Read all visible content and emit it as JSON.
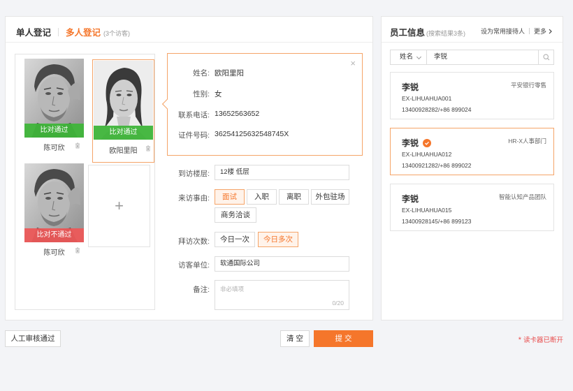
{
  "tabs": {
    "single": "单人登记",
    "multi": "多人登记",
    "multi_count": "(3个访客)"
  },
  "visitors": [
    {
      "name": "陈可欣",
      "result": "比对通过",
      "status": "pass"
    },
    {
      "name": "欧阳里阳",
      "result": "比对通过",
      "status": "pass"
    },
    {
      "name": "陈可欣",
      "result": "比对不通过",
      "status": "fail"
    }
  ],
  "info": {
    "name_label": "姓名:",
    "name_value": "欧阳里阳",
    "gender_label": "性别:",
    "gender_value": "女",
    "phone_label": "联系电话:",
    "phone_value": "13652563652",
    "id_label": "证件号码:",
    "id_value": "36254125632548745X",
    "close_glyph": "×"
  },
  "form": {
    "floor_label": "到访楼层:",
    "floor_value": "12楼  低层",
    "reason_label": "来访事由:",
    "reasons": [
      "面试",
      "入职",
      "离职",
      "外包驻场",
      "商务洽谈"
    ],
    "reason_selected": "面试",
    "visits_label": "拜访次数:",
    "visits": [
      "今日一次",
      "今日多次"
    ],
    "visits_selected": "今日多次",
    "company_label": "访客单位:",
    "company_value": "软通国际公司",
    "note_label": "备注:",
    "note_placeholder": "非必填项",
    "note_counter": "0/20"
  },
  "employees": {
    "title": "员工信息",
    "subtitle": "(搜索结果3条)",
    "set_frequent": "设为常用接待人",
    "more": "更多",
    "search_field": "姓名",
    "search_value": "李锐",
    "list": [
      {
        "name": "李锐",
        "dept": "平安银行零售",
        "id": "EX-LIHUAHUA001",
        "phone": "13400928282/+86 899024",
        "selected": false
      },
      {
        "name": "李锐",
        "dept": "HR-X人事部门",
        "id": "EX-LIHUAHUA012",
        "phone": "13400921282/+86 899022",
        "selected": true
      },
      {
        "name": "李锐",
        "dept": "智能认知产品团队",
        "id": "EX-LIHUAHUA015",
        "phone": "13400928145/+86 899123",
        "selected": false
      }
    ]
  },
  "footer": {
    "manual_pass": "人工审核通过",
    "clear": "清 空",
    "submit": "提 交",
    "card_reader_status": "读卡器已断开",
    "status_marker": "*"
  },
  "colors": {
    "accent": "#f5762b",
    "pass": "#3fb53a",
    "fail": "#ec5858",
    "error_text": "#e84d4d"
  }
}
